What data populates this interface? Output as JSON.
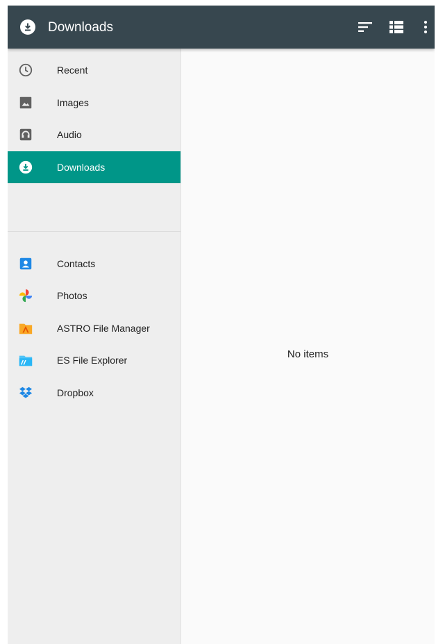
{
  "appbar": {
    "title": "Downloads",
    "app_icon": "download-circle-icon",
    "actions": [
      {
        "name": "sort-icon"
      },
      {
        "name": "list-view-icon"
      },
      {
        "name": "more-vert-icon"
      }
    ]
  },
  "sidebar": {
    "roots": [
      {
        "label": "Recent",
        "icon": "clock-icon",
        "selected": false
      },
      {
        "label": "Images",
        "icon": "image-icon",
        "selected": false
      },
      {
        "label": "Audio",
        "icon": "headphones-icon",
        "selected": false
      },
      {
        "label": "Downloads",
        "icon": "download-icon",
        "selected": true
      }
    ],
    "apps": [
      {
        "label": "Contacts",
        "icon": "contacts-icon"
      },
      {
        "label": "Photos",
        "icon": "pinwheel-icon"
      },
      {
        "label": "ASTRO File Manager",
        "icon": "astro-folder-icon"
      },
      {
        "label": "ES File Explorer",
        "icon": "es-folder-icon"
      },
      {
        "label": "Dropbox",
        "icon": "dropbox-icon"
      }
    ]
  },
  "content": {
    "empty_message": "No items"
  },
  "colors": {
    "appbar": "#37474f",
    "accent": "#009688",
    "sidebar_bg": "#eeeeee",
    "content_bg": "#fafafa"
  }
}
